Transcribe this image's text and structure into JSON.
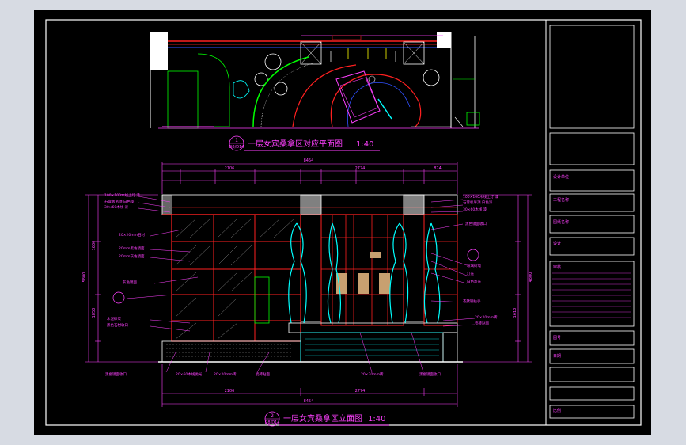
{
  "drawing": {
    "plan_caption": "一层女宾桑拿区对应平面图",
    "plan_scale": "1:40",
    "plan_tag_top": "1",
    "plan_tag_bottom": "D8/D14",
    "elevation_caption": "一层女宾桑拿区立面图",
    "elevation_scale": "1:40",
    "elevation_tag_top": "2",
    "elevation_tag_bottom": "D8/D14"
  },
  "dimensions": {
    "top_total": "8454",
    "bottom_total": "8454",
    "left_total": "5800",
    "right_total": "4800",
    "seg_a": "2106",
    "seg_b": "2774",
    "seg_c": "874",
    "seg_d": "1610",
    "seg_e": "3270",
    "left_upper": "1600",
    "left_lower": "1850"
  },
  "callouts": {
    "left": [
      "100×100木线上灯 漆",
      "石膏板吊顶 白色漆",
      "30×60木线 漆",
      "20×20mm石材",
      "20mm黑色镜面",
      "20mm灰色镜面",
      "灰色镜面",
      "水泥砂浆",
      "黑色石材收口",
      "石膏板吊顶"
    ],
    "right": [
      "100×100木线上灯 漆",
      "石膏板吊顶 白色漆",
      "30×60木线 漆",
      "黑色镜面收口",
      "玻璃砖墙",
      "灯光",
      "白色灯光",
      "不锈钢扶手",
      "20×20mm砖",
      "瓷砖贴面"
    ],
    "bottom": [
      "黑色镜面收口",
      "20×60木线抛光",
      "20×20mm砖",
      "瓷砖贴面",
      "20×20mm砖",
      "黑色镜面收口"
    ]
  },
  "title_block": {
    "rows": [
      "设计单位",
      "工程名称",
      "图纸名称",
      "设计",
      "审核",
      "图号",
      "日期",
      "比例"
    ]
  },
  "colors": {
    "background": "#000000",
    "frame": "#ffffff",
    "wall": "#ff2020",
    "dimension": "#ff40ff",
    "curtain": "#00ffff",
    "grid_frame": "#ff3030",
    "green_line": "#00ff00",
    "yellow": "#ffff00",
    "outer_bg": "#d7dbe3"
  }
}
